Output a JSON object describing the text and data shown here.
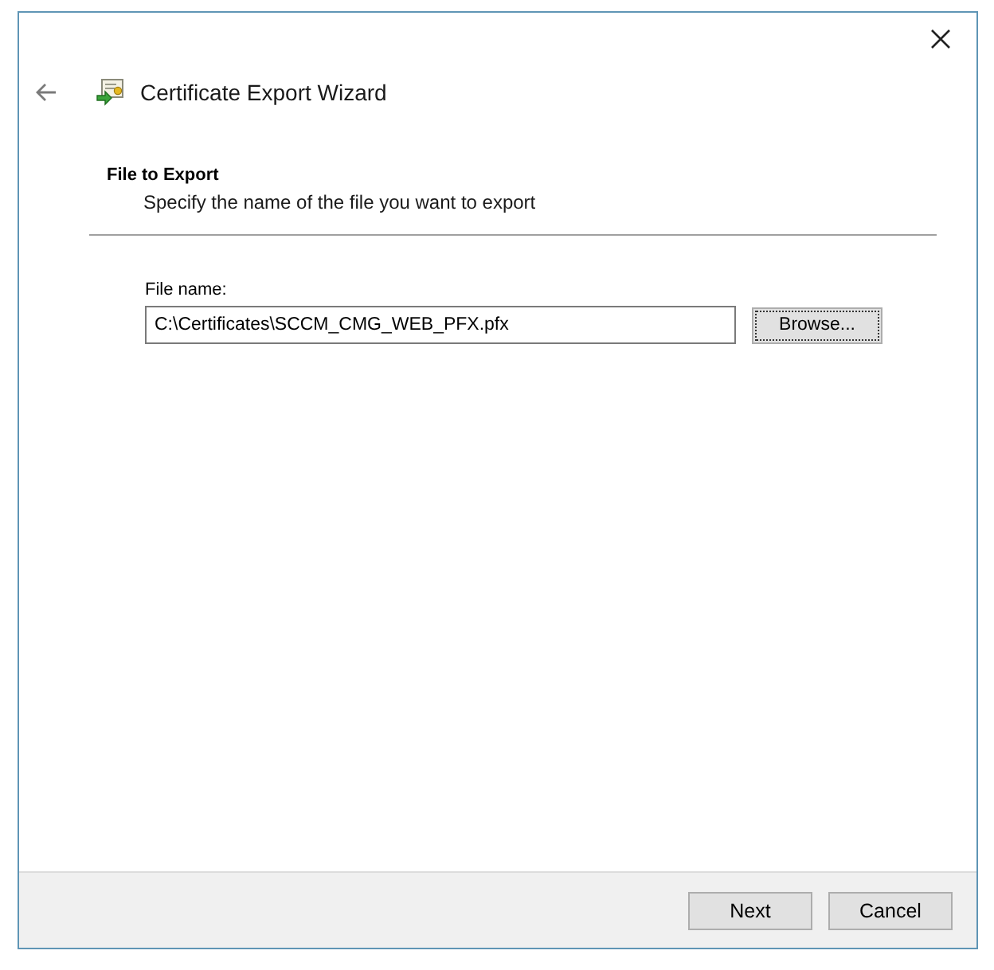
{
  "window": {
    "title": "Certificate Export Wizard"
  },
  "header": {
    "heading": "File to Export",
    "subheading": "Specify the name of the file you want to export"
  },
  "file_field": {
    "label": "File name:",
    "value": "C:\\Certificates\\SCCM_CMG_WEB_PFX.pfx"
  },
  "browse_button": {
    "label": "Browse...",
    "focused": true
  },
  "buttons": [
    {
      "label": "Next"
    },
    {
      "label": "Cancel"
    }
  ]
}
